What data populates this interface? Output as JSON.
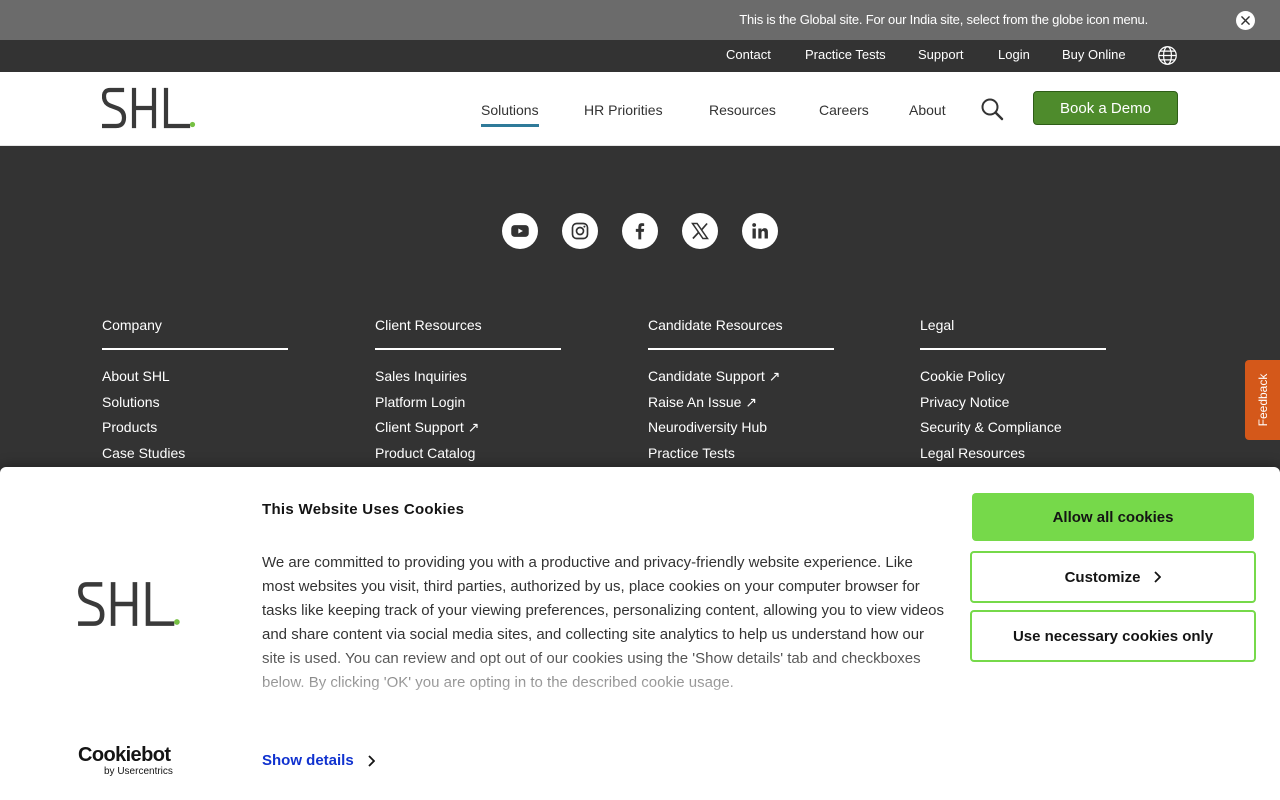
{
  "banner": {
    "text": "This is the Global site. For our India site, select from the globe icon menu.",
    "close_icon": "close-icon"
  },
  "utility_nav": {
    "contact": "Contact",
    "practice_tests": "Practice Tests",
    "support": "Support",
    "login": "Login",
    "buy_online": "Buy Online",
    "globe_icon": "globe-icon"
  },
  "header": {
    "logo_text": "SHL",
    "nav": {
      "solutions": "Solutions",
      "hr_priorities": "HR Priorities",
      "resources": "Resources",
      "careers": "Careers",
      "about": "About"
    },
    "search_icon": "search-icon",
    "cta": "Book a Demo",
    "colors": {
      "cta": "#4e8b2c",
      "active_underline": "#2f7a99",
      "logo_dot": "#76c043"
    }
  },
  "footer": {
    "social_icons": [
      "youtube-icon",
      "instagram-icon",
      "facebook-icon",
      "x-icon",
      "linkedin-icon"
    ],
    "columns": {
      "company": {
        "heading": "Company",
        "links": [
          "About SHL",
          "Solutions",
          "Products",
          "Case Studies"
        ]
      },
      "client": {
        "heading": "Client Resources",
        "links": [
          "Sales Inquiries",
          "Platform Login",
          "Client Support ↗",
          "Product Catalog"
        ]
      },
      "candidate": {
        "heading": "Candidate Resources",
        "links": [
          "Candidate Support ↗",
          "Raise An Issue ↗",
          "Neurodiversity Hub",
          "Practice Tests"
        ]
      },
      "legal": {
        "heading": "Legal",
        "links": [
          "Cookie Policy",
          "Privacy Notice",
          "Security & Compliance",
          "Legal Resources"
        ]
      }
    }
  },
  "feedback": {
    "label": "Feedback",
    "color": "#d4581a"
  },
  "cookie_banner": {
    "title": "This Website Uses Cookies",
    "body": "We are committed to providing you with a productive and privacy-friendly website experience. Like most websites you visit, third parties, authorized by us, place cookies on your computer browser for tasks like keeping track of your viewing preferences, personalizing content, allowing you to view videos and share content via social media sites, and collecting site analytics to help us understand how our site is used. You can review and opt out of our cookies using the 'Show details' tab and checkboxes below. By clicking 'OK' you are opting in to the described cookie usage.",
    "show_details": "Show details",
    "allow_all": "Allow all cookies",
    "customize": "Customize",
    "necessary_only": "Use necessary cookies only",
    "brand": "Cookiebot",
    "brand_sub": "by Usercentrics",
    "colors": {
      "button": "#76d94a",
      "link": "#1032cf"
    }
  }
}
